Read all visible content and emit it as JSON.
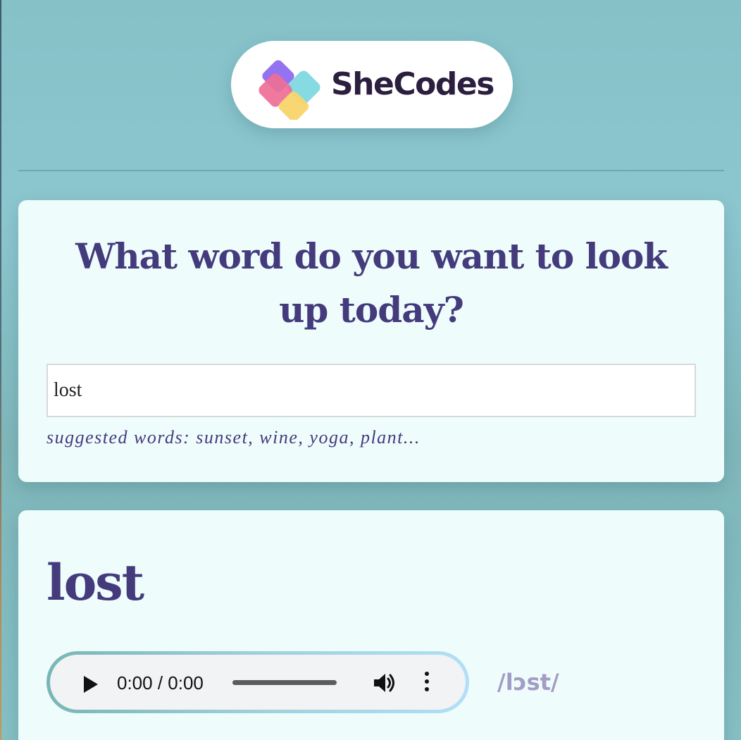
{
  "logo": {
    "brand_name": "SheCodes",
    "icon": "shecodes-logo-icon"
  },
  "search": {
    "heading": "What word do you want to look up today?",
    "input_value": "lost",
    "suggestions_text": "suggested words: sunset, wine, yoga, plant..."
  },
  "result": {
    "word": "lost",
    "phonetic": "/lɔst/",
    "audio": {
      "time_display": "0:00 / 0:00",
      "progress": 0,
      "icons": [
        "play-icon",
        "volume-icon",
        "more-options-icon"
      ]
    }
  },
  "colors": {
    "accent_text": "#443b7c",
    "phonetic": "#a39cc4",
    "background": "#86c1c8",
    "card": "#effcfc"
  }
}
